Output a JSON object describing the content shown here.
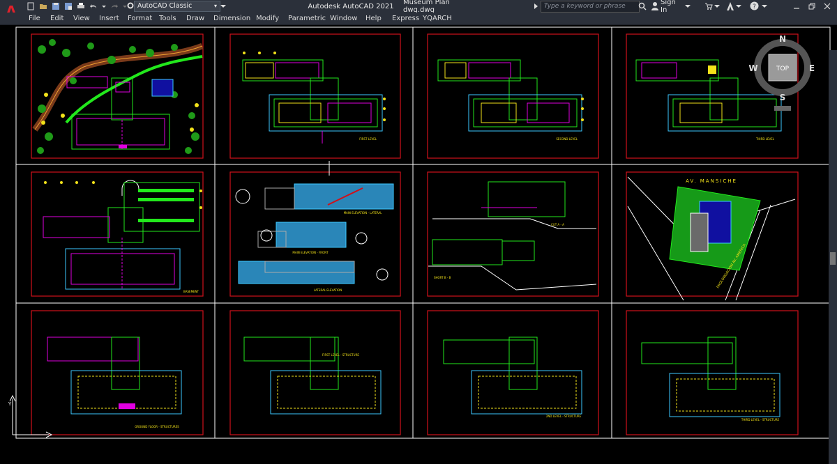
{
  "titlebar": {
    "app_title": "Autodesk AutoCAD 2021",
    "file_title": "Museum Plan dwg.dwg",
    "workspace": "AutoCAD Classic",
    "search_placeholder": "Type a keyword or phrase",
    "sign_in": "Sign In"
  },
  "menu": {
    "items": [
      "File",
      "Edit",
      "View",
      "Insert",
      "Format",
      "Tools",
      "Draw",
      "Dimension",
      "Modify",
      "Parametric",
      "Window",
      "Help",
      "Express",
      "YQARCH"
    ]
  },
  "viewcube": {
    "top": "TOP",
    "north": "N",
    "south": "S",
    "east": "E",
    "west": "W"
  },
  "sheets": {
    "first_level": "FIRST LEVEL",
    "second_level": "SECOND LEVEL",
    "third_level": "THIRD LEVEL",
    "basement": "BASEMENT",
    "main_elev_lateral": "MAIN ELEVATION - LATERAL",
    "main_elev_front": "MAIN ELEVATION - FRONT",
    "lateral_elev": "LATERAL ELEVATION",
    "section_a": "CUT A - A",
    "section_b": "SHORT B - B",
    "street_1": "AV. MANSICHE",
    "street_2": "PROLONGACION AV. AMERICA",
    "ground_struct": "GROUND FLOOR - STRUCTURES",
    "first_struct": "FIRST LEVEL - STRUCTURE",
    "second_struct": "2ND LEVEL - STRUCTURE",
    "third_struct": "THIRD LEVEL - STRUCTURE"
  },
  "colors": {
    "chrome": "#2b303a",
    "grid": "#ffffff",
    "frame": "#d0101a",
    "accent_green": "#22e81c",
    "accent_magenta": "#e000e0",
    "accent_yellow": "#f2e21a",
    "accent_cyan": "#3cc8ff",
    "autodesk_red": "#e1212b"
  }
}
